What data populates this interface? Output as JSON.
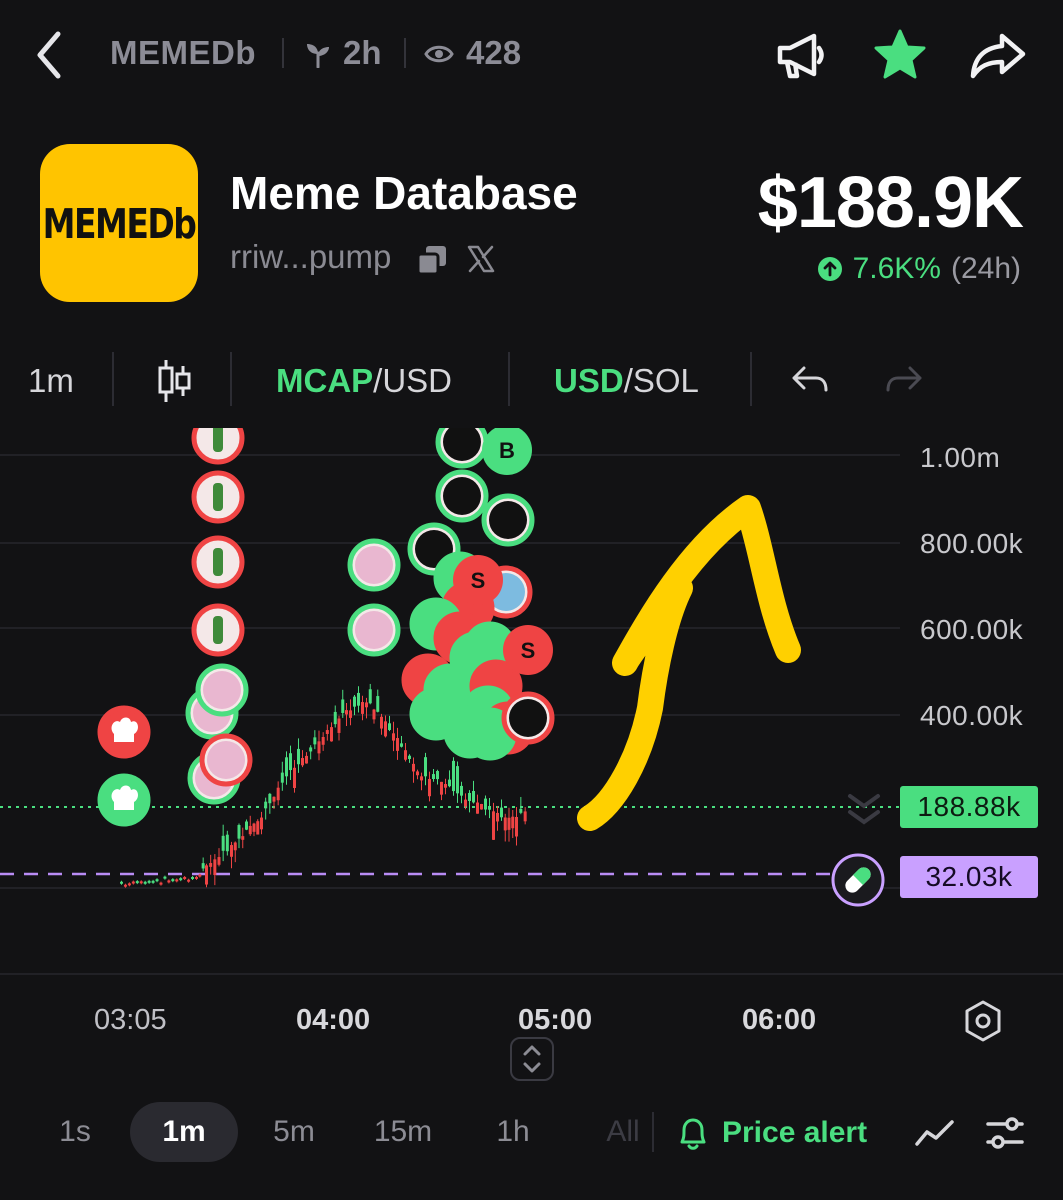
{
  "topbar": {
    "ticker": "MEMEDb",
    "age": "2h",
    "views": "428",
    "icons": [
      "back-icon",
      "sprout-icon",
      "eye-icon",
      "megaphone-icon",
      "star-icon",
      "share-icon"
    ],
    "star_color": "#4ade80"
  },
  "token": {
    "logo_text": "MEMEDb",
    "logo_color": "#ffc400",
    "name": "Meme Database",
    "address": "rriw...pump",
    "market_cap": "$188.9K",
    "change": "7.6K%",
    "period": "(24h)"
  },
  "chart_toolbar": {
    "interval": "1m",
    "mode_primary": "MCAP",
    "mode_secondary": "/USD",
    "currency_primary": "USD",
    "currency_secondary": "/SOL"
  },
  "chart": {
    "y_labels": [
      "1.00m",
      "800.00k",
      "600.00k",
      "400.00k"
    ],
    "current_price": "188.88k",
    "launch_price": "32.03k",
    "markers": [
      "B",
      "S",
      "S"
    ],
    "colors": {
      "up": "#4ade80",
      "down": "#ef4444",
      "launch": "#c9a0ff",
      "annotation": "#ffd000"
    }
  },
  "chart_data": {
    "type": "candlestick",
    "x_labels": [
      "03:05",
      "04:00",
      "05:00",
      "06:00"
    ],
    "y_ticks": [
      400000,
      600000,
      800000,
      1000000
    ],
    "ylim": [
      0,
      1050000
    ],
    "current_value": 188880,
    "launch_value": 32030
  },
  "time_axis": {
    "labels": [
      "03:05",
      "04:00",
      "05:00",
      "06:00"
    ]
  },
  "bottom_bar": {
    "timeframes": [
      "1s",
      "1m",
      "5m",
      "15m",
      "1h",
      "All"
    ],
    "active": "1m",
    "price_alert": "Price alert"
  }
}
